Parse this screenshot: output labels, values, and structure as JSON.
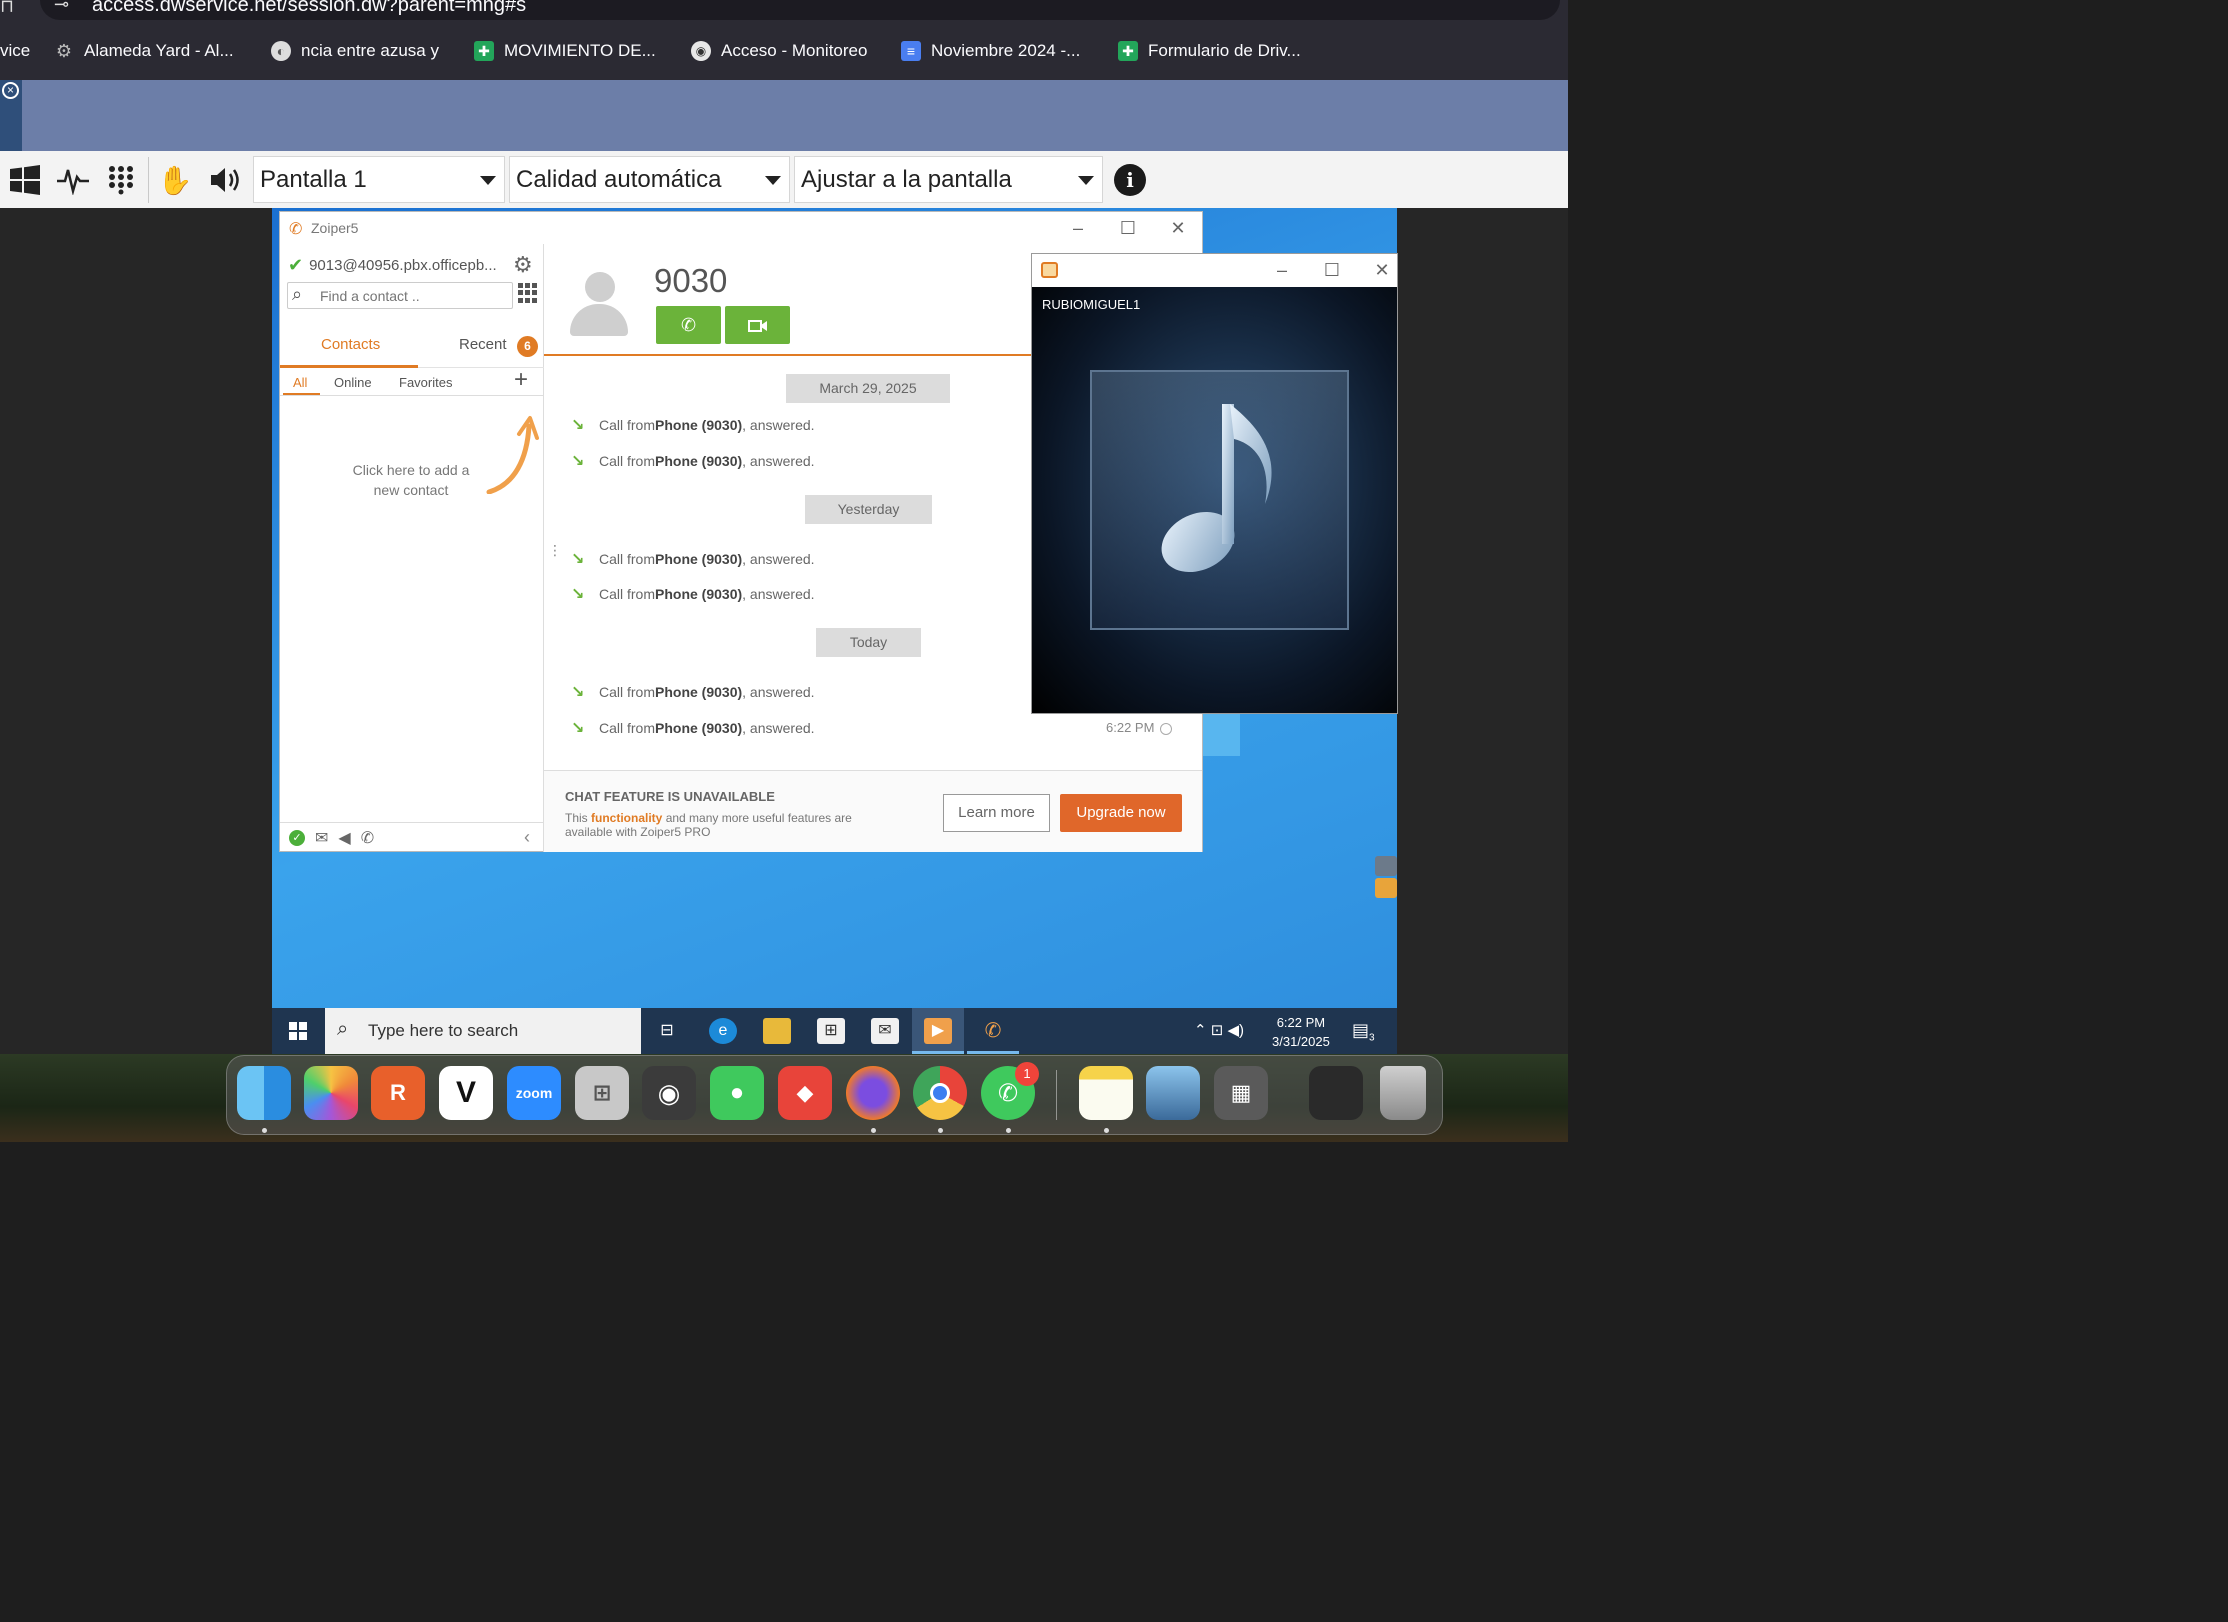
{
  "browser": {
    "url": "access.dwservice.net/session.dw?parent=mng#s",
    "bookmarks": [
      {
        "label": "vice",
        "icon": "none"
      },
      {
        "label": "Alameda Yard - Al...",
        "icon": "gear-favicon"
      },
      {
        "label": "ncia entre azusa y",
        "icon": "globe-favicon"
      },
      {
        "label": "MOVIMIENTO DE...",
        "icon": "sheets-favicon"
      },
      {
        "label": "Acceso - Monitoreo",
        "icon": "camera-favicon"
      },
      {
        "label": "Noviembre 2024 -...",
        "icon": "docs-favicon"
      },
      {
        "label": "Formulario de Driv...",
        "icon": "sheets-favicon"
      }
    ]
  },
  "dw_toolbar": {
    "screen_select": "Pantalla 1",
    "quality_select": "Calidad automática",
    "fit_select": "Ajustar a la pantalla",
    "info": "i"
  },
  "zoiper": {
    "title": "Zoiper5",
    "account": "9013@40956.pbx.officepb...",
    "search_placeholder": "Find a contact ..",
    "tabs": {
      "contacts": "Contacts",
      "recent": "Recent",
      "recent_badge": "6"
    },
    "subtabs": {
      "all": "All",
      "online": "Online",
      "favorites": "Favorites"
    },
    "add_hint": "Click here to add a new contact",
    "contact_number": "9030",
    "history": {
      "dates": [
        "March 29, 2025",
        "Yesterday",
        "Today"
      ],
      "call_prefix": "Call from ",
      "call_name": "Phone (9030)",
      "call_suffix": ", answered.",
      "last_time": "6:22 PM"
    },
    "chat": {
      "title": "CHAT FEATURE IS UNAVAILABLE",
      "line_pre": "This ",
      "line_hl": "functionality",
      "line_post": " and many more useful features are available with Zoiper5 PRO",
      "learn_more": "Learn more",
      "upgrade": "Upgrade now"
    },
    "accent_color": "#e07b24",
    "call_color": "#6bb33a"
  },
  "player": {
    "track_name": "RUBIOMIGUEL1"
  },
  "taskbar": {
    "search_placeholder": "Type here to search",
    "time": "6:22 PM",
    "date": "3/31/2025",
    "notification_count": "3"
  },
  "dock": {
    "zoom_label": "zoom",
    "whatsapp_badge": "1"
  }
}
